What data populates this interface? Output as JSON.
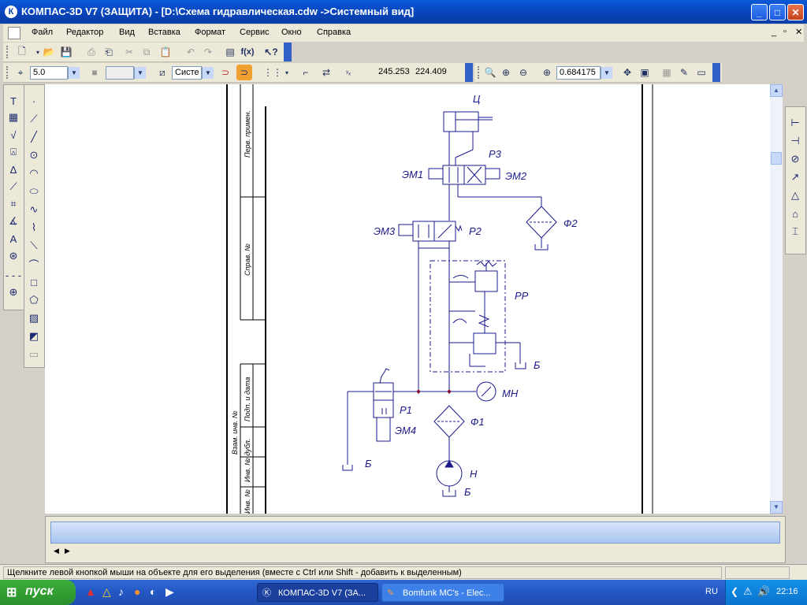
{
  "window": {
    "title": "КОМПАС-3D V7 (ЗАЩИТА) - [D:\\Схема гидравлическая.cdw ->Системный вид]",
    "app_icon": "kompas-logo-icon",
    "minimize_icon": "minimize-icon",
    "maximize_icon": "maximize-icon",
    "close_icon": "close-icon"
  },
  "menu": {
    "items": [
      "Файл",
      "Редактор",
      "Вид",
      "Вставка",
      "Формат",
      "Сервис",
      "Окно",
      "Справка"
    ]
  },
  "toolbar_std": {
    "icons": [
      "new-document-icon",
      "open-folder-icon",
      "save-icon",
      "print-icon",
      "print-preview-icon",
      "cut-icon",
      "copy-icon",
      "paste-icon",
      "undo-icon",
      "redo-icon",
      "manager-icon",
      "function-icon",
      "help-pointer-icon"
    ],
    "fx_label": "f(x)"
  },
  "toolbar_props": {
    "line_width": "5.0",
    "layer_field": "",
    "system_field": "Систе",
    "coord_x": "245.253",
    "coord_y": "224.409",
    "zoom": "0.684175"
  },
  "schematic": {
    "labels": {
      "cylinder": "Ц",
      "p3": "Р3",
      "em1": "ЭМ1",
      "em2": "ЭМ2",
      "f2": "Ф2",
      "em3": "ЭМ3",
      "p2": "Р2",
      "rp": "РР",
      "b1": "Б",
      "mn": "МН",
      "p1": "Р1",
      "em4": "ЭМ4",
      "f1": "Ф1",
      "b2": "Б",
      "n": "Н",
      "b3": "Б"
    },
    "frame_labels": {
      "perv_primen": "Перв. примен.",
      "sprav_no": "Справ. №",
      "podp_data": "Подп. и дата",
      "vzam_inv": "Взам. инв. №",
      "inv_dubl": "Инв. № дубл.",
      "inv_podl": "Инв. №"
    }
  },
  "statusbar": {
    "text": "Щелкните левой кнопкой мыши на объекте для его выделения (вместе с Ctrl или Shift - добавить к выделенным)"
  },
  "taskbar": {
    "start_label": "пуск",
    "tasks": [
      "КОМПАС-3D V7 (ЗА...",
      "Bomfunk MC's - Elec..."
    ],
    "lang": "RU",
    "clock": "22:16"
  },
  "colors": {
    "titlebar": "#0842b8",
    "drawing_line": "#1a1a8c",
    "taskbar": "#2457c4"
  }
}
